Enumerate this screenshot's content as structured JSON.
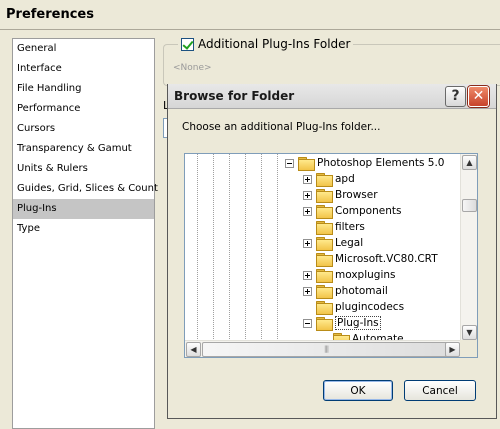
{
  "window": {
    "title": "Preferences"
  },
  "sidebar": {
    "items": [
      {
        "label": "General",
        "selected": false
      },
      {
        "label": "Interface",
        "selected": false
      },
      {
        "label": "File Handling",
        "selected": false
      },
      {
        "label": "Performance",
        "selected": false
      },
      {
        "label": "Cursors",
        "selected": false
      },
      {
        "label": "Transparency & Gamut",
        "selected": false
      },
      {
        "label": "Units & Rulers",
        "selected": false
      },
      {
        "label": "Guides, Grid, Slices & Count",
        "selected": false
      },
      {
        "label": "Plug-Ins",
        "selected": true
      },
      {
        "label": "Type",
        "selected": false
      }
    ]
  },
  "plugins_panel": {
    "checkbox_label": "Additional Plug-Ins Folder",
    "checkbox_checked": true,
    "folder_value": "<None>",
    "label_stub": "L"
  },
  "dialog": {
    "title": "Browse for Folder",
    "help_glyph": "?",
    "close_glyph": "✕",
    "instruction": "Choose an additional Plug-Ins folder...",
    "tree": [
      {
        "label": "Photoshop Elements 5.0",
        "expander": "minus",
        "level": 0,
        "selected": false
      },
      {
        "label": "apd",
        "expander": "plus",
        "level": 1,
        "selected": false
      },
      {
        "label": "Browser",
        "expander": "plus",
        "level": 1,
        "selected": false
      },
      {
        "label": "Components",
        "expander": "plus",
        "level": 1,
        "selected": false
      },
      {
        "label": "filters",
        "expander": "none",
        "level": 1,
        "selected": false
      },
      {
        "label": "Legal",
        "expander": "plus",
        "level": 1,
        "selected": false
      },
      {
        "label": "Microsoft.VC80.CRT",
        "expander": "none",
        "level": 1,
        "selected": false
      },
      {
        "label": "moxplugins",
        "expander": "plus",
        "level": 1,
        "selected": false
      },
      {
        "label": "photomail",
        "expander": "plus",
        "level": 1,
        "selected": false
      },
      {
        "label": "plugincodecs",
        "expander": "none",
        "level": 1,
        "selected": false
      },
      {
        "label": "Plug-Ins",
        "expander": "minus",
        "level": 1,
        "selected": true
      },
      {
        "label": "Automate",
        "expander": "none",
        "level": 2,
        "selected": false
      }
    ],
    "ok_label": "OK",
    "cancel_label": "Cancel"
  },
  "colors": {
    "chrome": "#ece9d8",
    "selection_gray": "#c5c5c5",
    "close_red": "#c7432b",
    "button_border": "#003c74"
  }
}
